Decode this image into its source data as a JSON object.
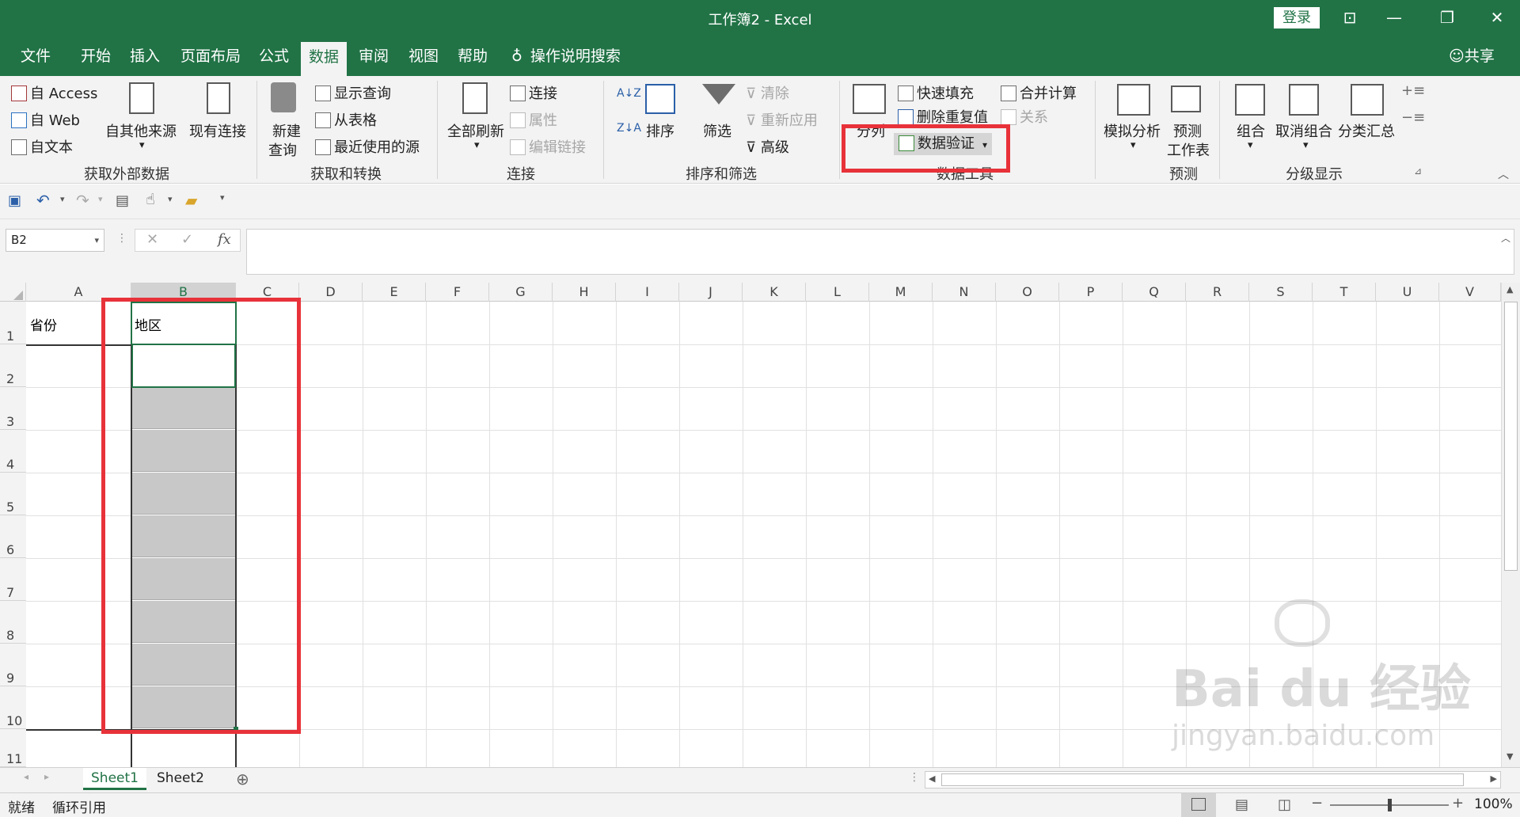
{
  "window": {
    "title": "工作簿2 - Excel",
    "login": "登录",
    "share": "共享"
  },
  "menu": {
    "tabs": [
      "文件",
      "开始",
      "插入",
      "页面布局",
      "公式",
      "数据",
      "审阅",
      "视图",
      "帮助"
    ],
    "active_tab": "数据",
    "tell_me": "操作说明搜索"
  },
  "ribbon": {
    "get_external": {
      "label": "获取外部数据",
      "access": "自 Access",
      "web": "自 Web",
      "text": "自文本",
      "other": "自其他来源",
      "existing": "现有连接"
    },
    "get_transform": {
      "label": "获取和转换",
      "new_query_1": "新建",
      "new_query_2": "查询",
      "show_queries": "显示查询",
      "from_table": "从表格",
      "recent": "最近使用的源"
    },
    "connections": {
      "label": "连接",
      "refresh_all": "全部刷新",
      "connections": "连接",
      "properties": "属性",
      "edit_links": "编辑链接"
    },
    "sort_filter": {
      "label": "排序和筛选",
      "sort": "排序",
      "filter": "筛选",
      "clear": "清除",
      "reapply": "重新应用",
      "advanced": "高级"
    },
    "data_tools": {
      "label": "数据工具",
      "text_to_cols": "分列",
      "flash_fill": "快速填充",
      "remove_dup": "删除重复值",
      "validation": "数据验证",
      "consolidate": "合并计算",
      "relations": "关系"
    },
    "forecast": {
      "label": "预测",
      "whatif": "模拟分析",
      "sheet_1": "预测",
      "sheet_2": "工作表"
    },
    "outline": {
      "label": "分级显示",
      "group": "组合",
      "ungroup": "取消组合",
      "subtotal": "分类汇总"
    }
  },
  "formula_bar": {
    "name_box": "B2",
    "fx": "fx",
    "value": ""
  },
  "grid": {
    "columns": [
      "A",
      "B",
      "C",
      "D",
      "E",
      "F",
      "G",
      "H",
      "I",
      "J",
      "K",
      "L",
      "M",
      "N",
      "O",
      "P",
      "Q",
      "R",
      "S",
      "T",
      "U",
      "V"
    ],
    "rows": [
      "1",
      "2",
      "3",
      "4",
      "5",
      "6",
      "7",
      "8",
      "9",
      "10",
      "11"
    ],
    "selected_column": "B",
    "cells": {
      "A1": "省份",
      "B1": "地区"
    }
  },
  "sheets": {
    "tabs": [
      "Sheet1",
      "Sheet2"
    ],
    "active": "Sheet1"
  },
  "status": {
    "ready": "就绪",
    "circular": "循环引用",
    "zoom": "100%"
  },
  "watermark": {
    "brand": "Bai du 经验",
    "url": "jingyan.baidu.com"
  },
  "colors": {
    "excel_green": "#217346",
    "highlight_red": "#e8323a",
    "selection_gray": "#c8c8c8"
  }
}
